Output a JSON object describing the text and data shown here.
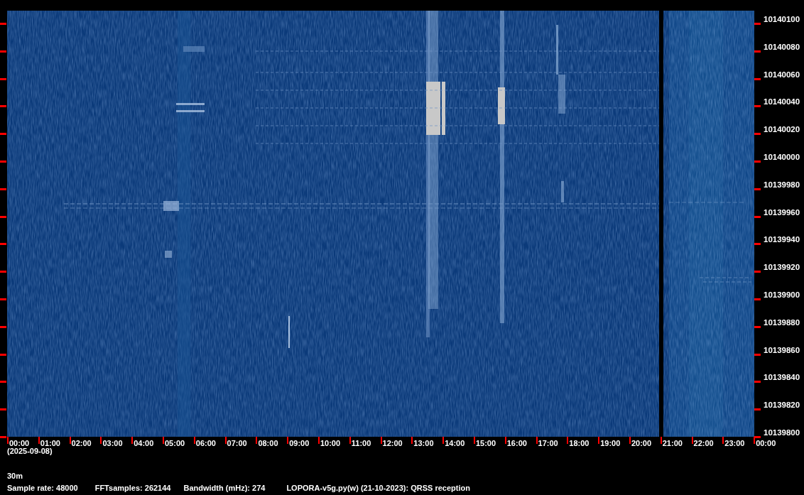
{
  "spectrogram": {
    "frequency_labels": [
      "10140100",
      "10140080",
      "10140060",
      "10140040",
      "10140020",
      "10140000",
      "10139980",
      "10139960",
      "10139940",
      "10139920",
      "10139900",
      "10139880",
      "10139860",
      "10139840",
      "10139820",
      "10139800"
    ],
    "time_labels": [
      "00:00",
      "01:00",
      "02:00",
      "03:00",
      "04:00",
      "05:00",
      "06:00",
      "07:00",
      "08:00",
      "09:00",
      "10:00",
      "11:00",
      "12:00",
      "13:00",
      "14:00",
      "15:00",
      "16:00",
      "17:00",
      "18:00",
      "19:00",
      "20:00",
      "21:00",
      "22:00",
      "23:00",
      "00:00"
    ],
    "date": "(2025-09-08)",
    "band": "30m",
    "info": [
      "Sample rate: 48000",
      "FFTsamples: 262144",
      "Bandwidth (mHz): 274",
      "LOPORA-v5g.py(w) (21-10-2023): QRSS reception"
    ]
  }
}
